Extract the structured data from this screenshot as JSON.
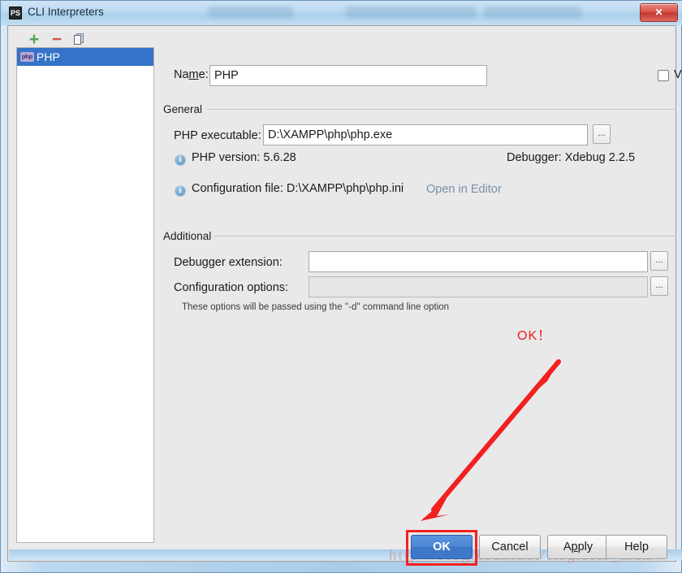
{
  "window": {
    "title": "CLI Interpreters",
    "app_icon": "PS",
    "close_label": "✕"
  },
  "sidebar": {
    "toolbar": [
      {
        "name": "add",
        "glyph": "+"
      },
      {
        "name": "remove",
        "glyph": "−"
      },
      {
        "name": "copy",
        "glyph": "❐"
      }
    ],
    "items": [
      {
        "label": "PHP",
        "badge": "php",
        "selected": true
      }
    ]
  },
  "form": {
    "name_label_a": "Na",
    "name_label_mnemonic": "m",
    "name_label_b": "e:",
    "name_value": "PHP",
    "visible_only_label": "Visible only for this project",
    "visible_only_checked": false,
    "general_group": "General",
    "php_executable_label": "PHP executable:",
    "php_executable_value": "D:\\XAMPP\\php\\php.exe",
    "browse_label": "...",
    "refresh_icon": "↻",
    "php_version_text": "PHP version: 5.6.28",
    "debugger_text": "Debugger: Xdebug 2.2.5",
    "configuration_file_text": "Configuration file: D:\\XAMPP\\php\\php.ini",
    "open_in_editor_link": "Open in Editor",
    "additional_group": "Additional",
    "debugger_extension_label": "Debugger extension:",
    "debugger_extension_value": "",
    "configuration_options_label": "Configuration options:",
    "configuration_options_value": "",
    "options_hint": "These options will be passed using the ''-d'' command line option"
  },
  "buttons": {
    "ok": "OK",
    "cancel": "Cancel",
    "apply_a": "A",
    "apply_mnemonic": "p",
    "apply_b": "ply",
    "help": "Help"
  },
  "annotations": {
    "ok_note": "OK！",
    "watermark": "http://blog.csdn.net/Register_man",
    "accent_red": "#f32020",
    "accent_blue": "#3d76c6"
  }
}
